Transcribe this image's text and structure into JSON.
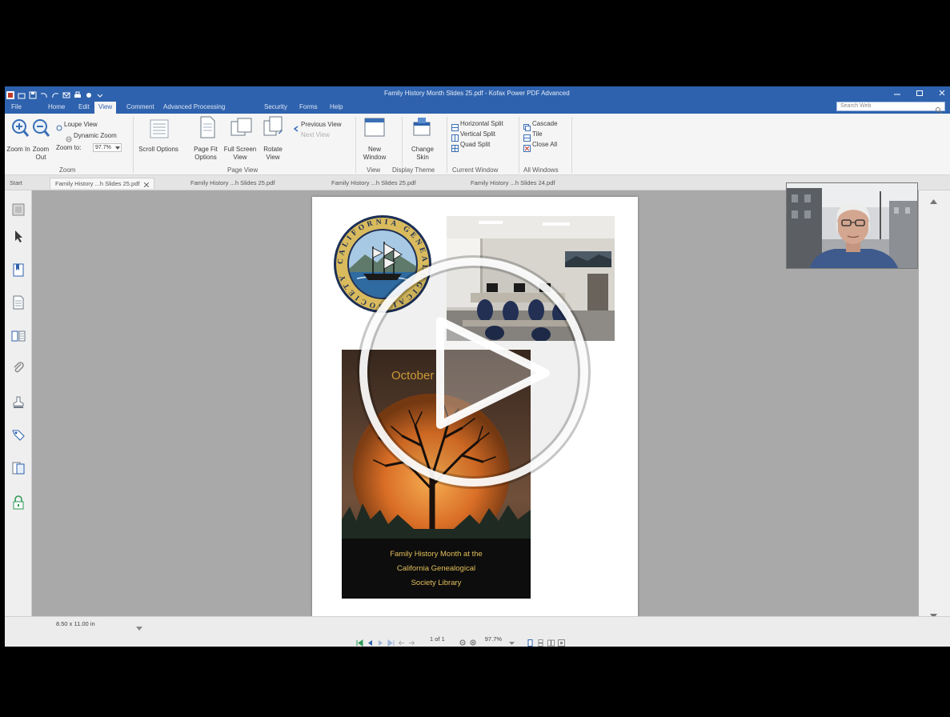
{
  "window": {
    "title": "Family History Month Slides 25.pdf - Kofax Power PDF Advanced"
  },
  "menu": {
    "tabs": [
      "File",
      "Home",
      "Edit",
      "View",
      "Comment",
      "Advanced Processing",
      "Security",
      "Forms",
      "Help"
    ]
  },
  "search": {
    "placeholder": "Search Web"
  },
  "ribbon": {
    "zoom_group": {
      "label": "Zoom",
      "zoom_in": "Zoom In",
      "zoom_out": "Zoom Out",
      "loupe_view": "Loupe View",
      "dynamic_zoom": "Dynamic Zoom",
      "zoom_to": "Zoom to:",
      "zoom_value": "97.7%"
    },
    "page_view_group": {
      "label": "Page View",
      "scroll_options": "Scroll Options",
      "page_fit_options": "Page Fit Options",
      "full_screen_view": "Full Screen View",
      "rotate_view": "Rotate View",
      "previous_view": "Previous View",
      "next_view": "Next View"
    },
    "view_group": {
      "label": "View",
      "new_window": "New Window"
    },
    "display_theme_group": {
      "label": "Display Theme",
      "change_skin": "Change Skin"
    },
    "current_window_group": {
      "label": "Current Window",
      "horizontal_split": "Horizontal Split",
      "vertical_split": "Vertical Split",
      "quad_split": "Quad Split"
    },
    "all_windows_group": {
      "label": "All Windows",
      "cascade": "Cascade",
      "tile": "Tile",
      "close_all": "Close All"
    }
  },
  "document_tabs": {
    "start": "Start",
    "tabs": [
      "Family History ...h Slides 25.pdf",
      "Family History ...h Slides 25.pdf",
      "Family History ...h Slides 25.pdf",
      "Family History ...h Slides 24.pdf"
    ]
  },
  "sidebar": {
    "icons": [
      "pages-panel-icon",
      "select-arrow-icon",
      "bookmark-icon",
      "page-icon",
      "thumbnails-icon",
      "attachment-icon",
      "stamp-icon",
      "tag-icon",
      "layers-icon",
      "lock-icon"
    ]
  },
  "page": {
    "seal_text": "CALIFORNIA GENEALOGICAL SOCIETY",
    "poster": {
      "heading": "October",
      "text_lines": [
        "Family History Month at the",
        "California Genealogical",
        "Society Library"
      ]
    }
  },
  "status_bar": {
    "page_size": "8.50 x 11.00 in",
    "page_indicator": "1 of 1",
    "zoom": "97.7%"
  },
  "colors": {
    "title_bar": "#2e62ae",
    "ribbon": "#f5f5f5",
    "workspace": "#a9a9a9",
    "poster_text": "#e3bf5a"
  }
}
